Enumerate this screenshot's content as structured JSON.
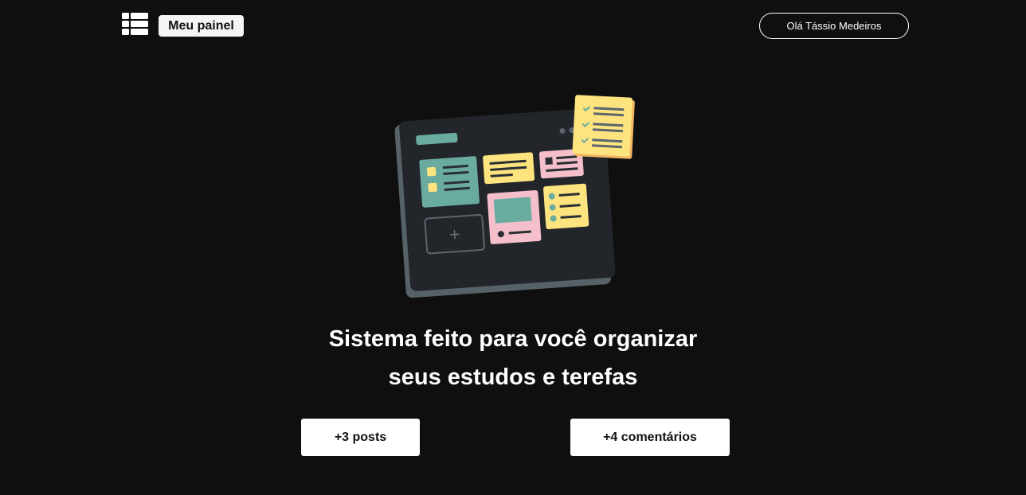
{
  "header": {
    "panel_label": "Meu painel",
    "greeting": "Olá Tássio Medeiros"
  },
  "hero": {
    "illustration_icon": "dashboard-board-illustration",
    "title_line1": "Sistema feito para você organizar",
    "title_line2": "seus estudos e terefas"
  },
  "stats": {
    "posts": "+3 posts",
    "comments": "+4 comentários"
  },
  "colors": {
    "background": "#0f0f0f",
    "board": "#22262b",
    "teal": "#6aaba0",
    "yellow": "#fde47f",
    "pink": "#f4bfcb"
  },
  "icons": {
    "logo": "list-grid-icon"
  }
}
